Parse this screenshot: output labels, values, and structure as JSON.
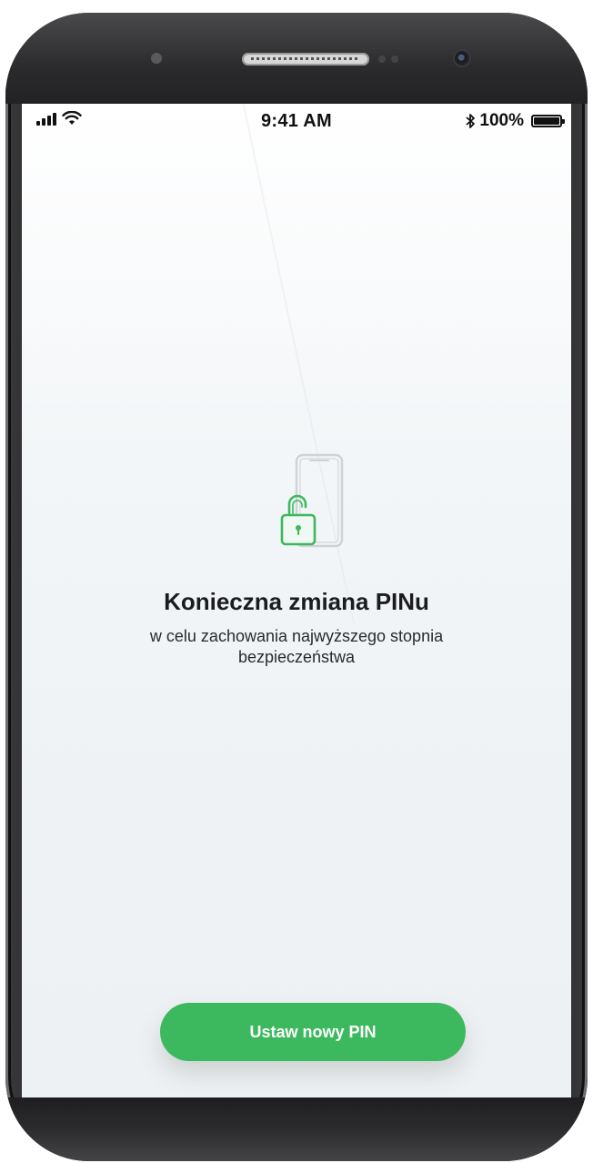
{
  "status_bar": {
    "time": "9:41 AM",
    "battery": "100%"
  },
  "screen": {
    "title": "Konieczna zmiana PINu",
    "subtitle": "w celu zachowania najwyższego stopnia bezpieczeństwa",
    "button_label": "Ustaw nowy PIN"
  },
  "colors": {
    "accent": "#3cb95e",
    "background": "#eef2f4"
  },
  "icons": [
    "signal-icon",
    "wifi-icon",
    "bluetooth-icon",
    "battery-icon",
    "unlocked-padlock-phone-icon"
  ]
}
